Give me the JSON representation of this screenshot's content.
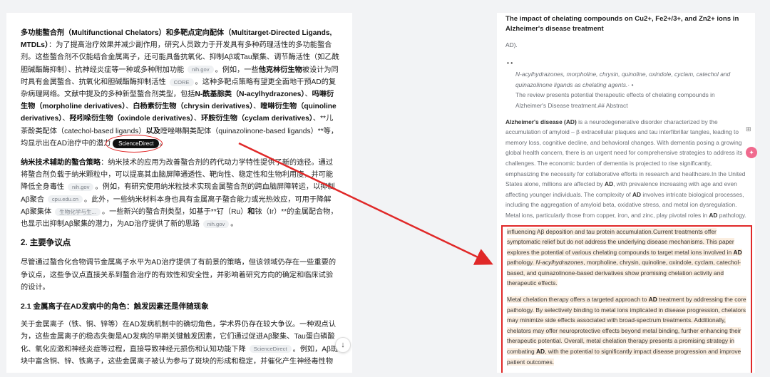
{
  "left": {
    "p1": {
      "t1": "多功能螯合剂（Multifunctional Chelators）和多靶点定向配体（Multitarget-Directed Ligands, MTDLs）",
      "t2": "：为了提高治疗效果并减少副作用，研究人员致力于开发具有多种药理活性的多功能螯合剂。这些螯合剂不仅能结合金属离子，还可能具备抗氧化、抑制Aβ或Tau聚集、调节酶活性（如乙酰胆碱酯酶抑制）、抗神经炎症等一种或多种附加功能",
      "badge1": "nih.gov",
      "t3": "。例如，一些",
      "t4": "他克林衍生物",
      "t5": "被设计为同时具有金属螯合、抗氧化和胆碱酯酶抑制活性",
      "badge2": "CORE",
      "t6": "。这种多靶点策略有望更全面地干预AD的复杂病理网络。文献中提及的多种新型螯合剂类型，包括",
      "t7": "N-酰基腙类（N-acylhydrazones）",
      "t8": "、",
      "t9": "吗啉衍生物（morpholine derivatives）",
      "t10": "、",
      "t11": "白杨素衍生物（chrysin derivatives）",
      "t12": "、",
      "t13": "喹啉衍生物（quinoline derivatives）",
      "t14": "、",
      "t15": "羟吲哚衍生物（oxindole derivatives）",
      "t16": "、",
      "t17": "环胺衍生物（cyclam derivatives）",
      "t18": "、**儿茶酚类配体（catechol-based ligands）",
      "t19": "以及",
      "t20": "喹唑啉酮类配体（quinazolinone-based ligands）**等，均显示出在AD治疗中的潜力",
      "badge3": "ScienceDirect",
      "t21": "。"
    },
    "p2": {
      "t1": "纳米技术辅助的螯合策略",
      "t2": "：纳米技术的应用为改善螯合剂的药代动力学特性提供了新的途径。通过将螯合剂负载于纳米颗粒中，可以提高其血脑屏障通透性、靶向性、稳定性和生物利用度，并可能降低全身毒性",
      "badge1": "nih.gov",
      "t3": "。例如，有研究使用纳米粒技术实现金属螯合剂的跨血脑屏障转运，以抑制Aβ聚合",
      "badge2": "cpu.edu.cn",
      "t4": "。此外，一些纳米材料本身也具有金属离子螯合能力或光热效应，可用于降解Aβ聚集体",
      "badge3": "生物化学与生...",
      "t5": "。一些新兴的螯合剂类型，如基于**钌（Ru）",
      "t6": "和",
      "t7": "铱（Ir）**的金属配合物，也显示出抑制Aβ聚集的潜力，为AD治疗提供了新的思路",
      "badge4": "nih.gov",
      "t8": "。"
    },
    "h2": "2. 主要争议点",
    "p3": "尽管通过螯合化合物调节金属离子水平为AD治疗提供了有前景的策略，但该领域仍存在一些重要的争议点，这些争议点直接关系到螯合治疗的有效性和安全性，并影响着研究方向的确定和临床试验的设计。",
    "h21": "2.1 金属离子在AD发病中的角色：触发因素还是伴随现象",
    "p4": {
      "t1": "关于金属离子（铁、铜、锌等）在AD发病机制中的确切角色，学术界仍存在较大争议。一种观点认为，这些金属离子的稳态失衡是AD发病的早期关键触发因素，它们通过促进Aβ聚集、Tau蛋白磷酸化、氧化应激和神经炎症等过程，直接导致神经元损伤和认知功能下降",
      "badge1": "ScienceDirect",
      "t2": "。例如，Aβ斑块中富含铜、锌、铁离子，这些金属离子被认为参与了斑块的形成和稳定，并催化产生神经毒性物"
    },
    "scroll_icon": "arrow-down"
  },
  "right": {
    "title": "The impact of chelating compounds on Cu2+, Fe2+/3+, and Zn2+ ions in Alzheimer's disease treatment",
    "ad": "AD).",
    "bullet": "•  •",
    "ref1": "N-acylhydrazones, morpholine, chrysin, quinoline, oxindole, cyclam, catechol and quinazolinone ligands as chelating agents.·  •",
    "ref2": "The review presents potential therapeutic effects of chelating compounds in Alzheimer's Disease treatment.## Abstract",
    "abs": {
      "b1": "Alzheimer's disease (AD)",
      "t1": " is a neurodegenerative disorder characterized by the accumulation of amyloid – β extracellular plaques and tau interfibrillar tangles, leading to memory loss, cognitive decline, and behavioral changes. With dementia posing a growing global health concern, there is an urgent need for comprehensive strategies to address its challenges. The economic burden of dementia is projected to rise significantly, emphasizing the necessity for collaborative efforts in research and healthcare.In the United States alone, millions are affected by ",
      "b2": "AD",
      "t2": ", with prevalence increasing with age and even affecting younger individuals. The complexity of ",
      "b3": "AD",
      "t3": " involves intricate biological processes, including the aggregation of amyloid beta, oxidative stress, and metal ion dysregulation. Metal ions, particularly those from copper, iron, and zinc, play pivotal roles in ",
      "b4": "AD",
      "t4": " pathology."
    },
    "hl1": {
      "t1": "influencing Aβ deposition and tau protein accumulation.",
      "t2": "Current treatments offer symptomatic relief but do not address the underlying disease mechanisms. This paper explores the potential of various chelating compounds to target metal ions involved in ",
      "b1": "AD",
      "t3": " pathology. ",
      "i1": "N-acylhydrazones",
      "t4": ", morpholine, chrysin, quinoline, oxindole, cyclam, catechol-based, and quinazolinone-based derivatives show promising chelation activity and therapeutic effects."
    },
    "hl2": {
      "t1": "Metal chelation therapy offers a targeted approach to ",
      "b1": "AD",
      "t2": " treatment by addressing the core pathology. By selectively binding to metal ions implicated in disease progression, chelators may minimize side effects associated with broad-spectrum treatments. Additionally, chelators may offer neuroprotective effects beyond metal binding, further enhancing their therapeutic potential. Overall, metal chelation therapy presents a promising strategy in combating ",
      "b2": "AD",
      "t3": ", with the potential to significantly impact disease progression and improve patient outcomes."
    }
  },
  "side": {
    "icon1": "translate-icon",
    "icon2": "assistant-icon"
  },
  "colors": {
    "annotation_red": "#e02828",
    "highlight": "#fbeee0"
  }
}
